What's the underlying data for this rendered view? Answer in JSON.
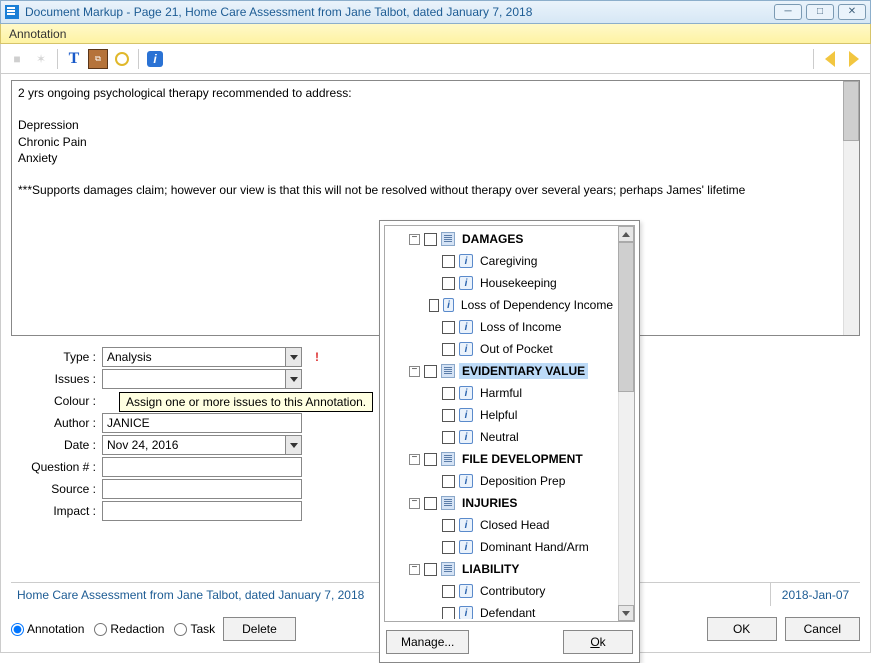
{
  "window": {
    "title": "Document Markup - Page 21, Home Care Assessment from Jane Talbot, dated January 7, 2018"
  },
  "menu": {
    "annotation": "Annotation"
  },
  "toolbar_icons": {
    "stop": "■",
    "puzzle": "✶",
    "text": "T",
    "form": "⧈",
    "highlight": "◯",
    "info": "i"
  },
  "text_content": "2 yrs ongoing psychological therapy recommended to address:\n\nDepression\nChronic Pain\nAnxiety\n\n***Supports damages claim; however our view is that this will not be resolved without therapy over several years; perhaps James' lifetime",
  "form": {
    "type_label": "Type :",
    "type_value": "Analysis",
    "issues_label": "Issues :",
    "issues_value": "",
    "colour_label": "Colour :",
    "author_label": "Author :",
    "author_value": "JANICE",
    "date_label": "Date :",
    "date_value": "Nov 24, 2016",
    "question_label": "Question # :",
    "question_value": "",
    "source_label": "Source :",
    "source_value": "",
    "impact_label": "Impact :",
    "impact_value": "",
    "tooltip": "Assign one or more issues to this Annotation."
  },
  "status": {
    "doc": "Home Care Assessment from Jane Talbot, dated January 7, 2018",
    "date": "2018-Jan-07"
  },
  "bottom": {
    "annotation": "Annotation",
    "redaction": "Redaction",
    "task": "Task",
    "delete": "Delete",
    "ok": "OK",
    "cancel": "Cancel"
  },
  "tree": {
    "groups": [
      {
        "label": "DAMAGES",
        "items": [
          "Caregiving",
          "Housekeeping",
          "Loss of Dependency Income",
          "Loss of Income",
          "Out of Pocket"
        ]
      },
      {
        "label": "EVIDENTIARY VALUE",
        "selected": true,
        "items": [
          "Harmful",
          "Helpful",
          "Neutral"
        ]
      },
      {
        "label": "FILE DEVELOPMENT",
        "items": [
          "Deposition Prep"
        ]
      },
      {
        "label": "INJURIES",
        "items": [
          "Closed Head",
          "Dominant Hand/Arm"
        ]
      },
      {
        "label": "LIABILITY",
        "items": [
          "Contributory",
          "Defendant"
        ]
      }
    ],
    "manage": "Manage...",
    "ok": "Ok"
  }
}
